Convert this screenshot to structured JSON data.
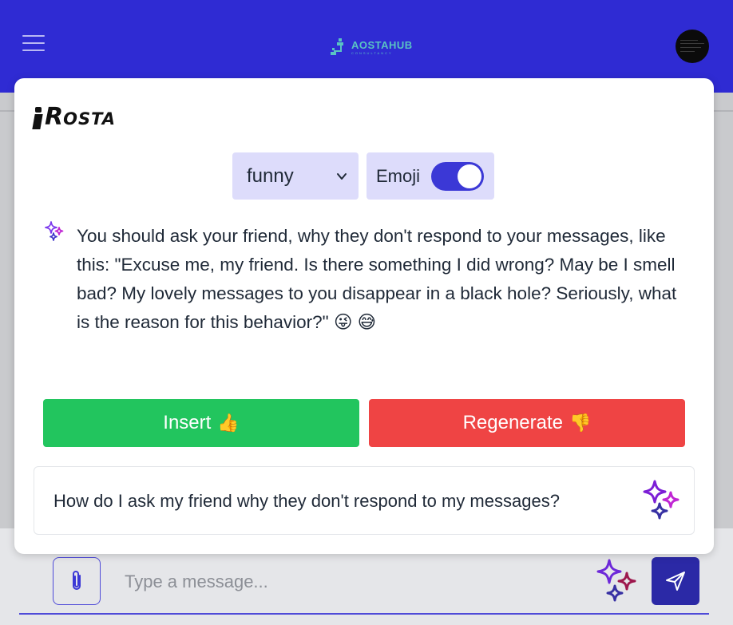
{
  "header": {
    "logo_name": "AOSTAHUB",
    "logo_tagline": "CONSULTANCY"
  },
  "chat_input": {
    "placeholder": "Type a message..."
  },
  "popup": {
    "brand_initial": "R",
    "brand_rest": "OSTA",
    "tone_select": {
      "value": "funny"
    },
    "emoji_toggle": {
      "label": "Emoji",
      "state": "on"
    },
    "answer_text": "You should ask your friend, why they don't respond to your messages, like this: \"Excuse me, my friend. Is there something I did wrong? May be I smell bad? My lovely messages to you disappear in a black hole? Seriously, what is the reason for this behavior?\"",
    "answer_emojis": "😜 😅",
    "insert_button": {
      "label": "Insert",
      "emoji": "👍"
    },
    "regenerate_button": {
      "label": "Regenerate",
      "emoji": "👎"
    },
    "prompt_text": "How do I ask my friend why they don't respond to my messages?"
  },
  "colors": {
    "header_bg": "#2f2bd3",
    "accent": "#3b38d6",
    "insert_green": "#22c55e",
    "regenerate_red": "#ef4444",
    "control_bg": "#dddcfb",
    "sparkle_purple": "#7c1fd6",
    "sparkle_magenta": "#c026d3"
  },
  "icons": [
    "menu-icon",
    "logo-icon",
    "avatar",
    "chevron-down-icon",
    "sparkle-icon",
    "thumbs-up-icon",
    "thumbs-down-icon",
    "paperclip-icon",
    "send-icon"
  ]
}
